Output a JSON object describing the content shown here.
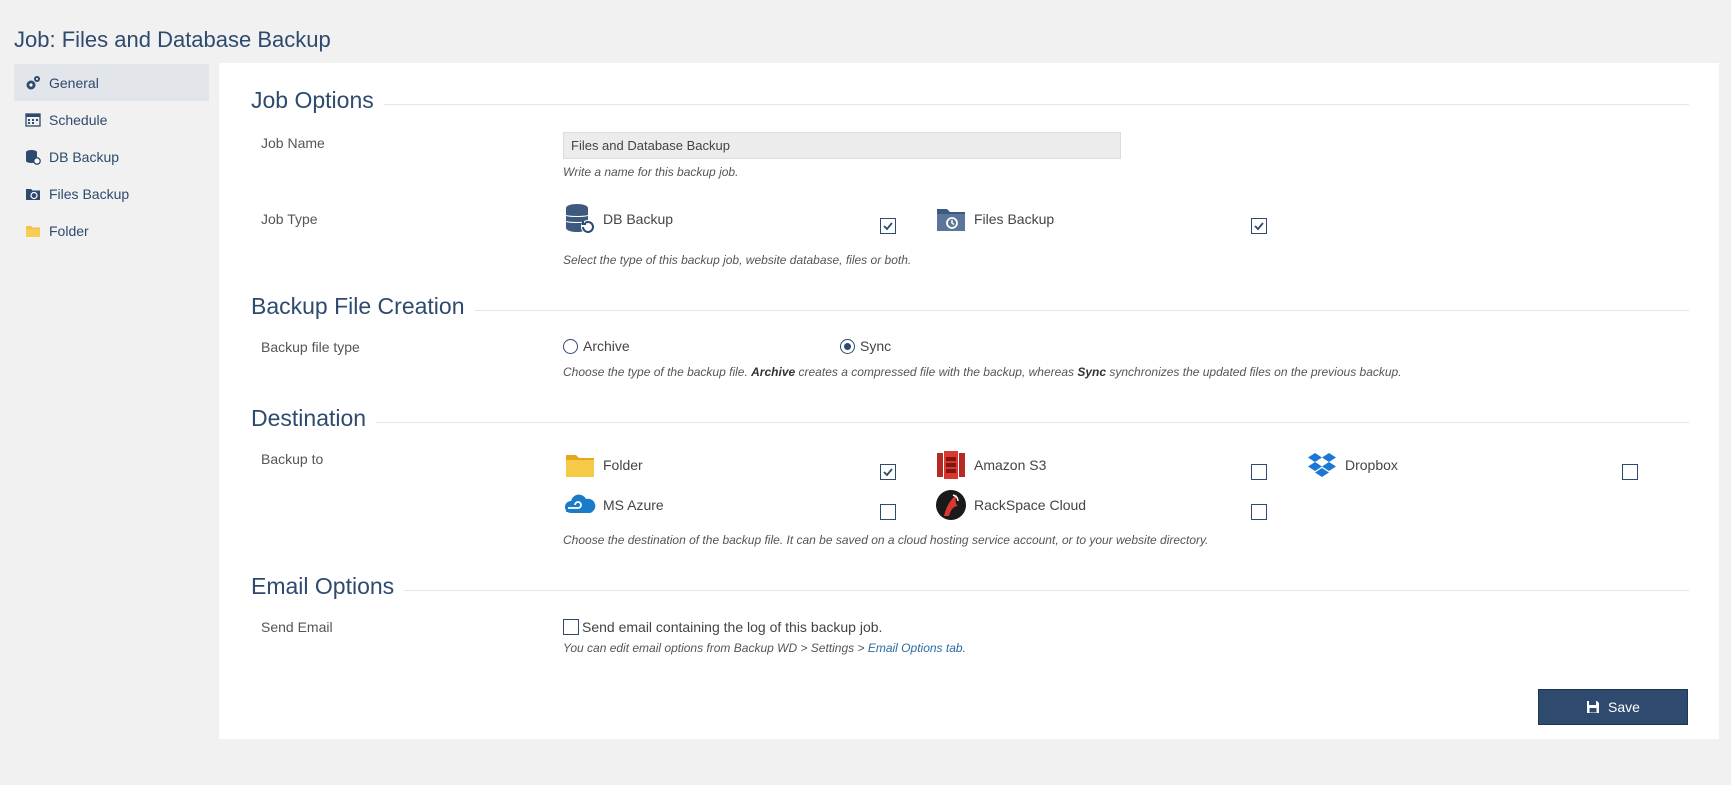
{
  "page_title": "Job: Files and Database Backup",
  "sidebar": {
    "items": [
      {
        "label": "General",
        "icon": "gear-icon",
        "active": true
      },
      {
        "label": "Schedule",
        "icon": "calendar-icon"
      },
      {
        "label": "DB Backup",
        "icon": "database-icon"
      },
      {
        "label": "Files Backup",
        "icon": "files-backup-icon"
      },
      {
        "label": "Folder",
        "icon": "folder-icon"
      }
    ]
  },
  "job_options": {
    "heading": "Job Options",
    "job_name": {
      "label": "Job Name",
      "value": "Files and Database Backup",
      "help": "Write a name for this backup job."
    },
    "job_type": {
      "label": "Job Type",
      "options": [
        {
          "label": "DB Backup",
          "icon": "database-restore-icon",
          "checked": true
        },
        {
          "label": "Files Backup",
          "icon": "folder-history-icon",
          "checked": true
        }
      ],
      "help": "Select the type of this backup job, website database, files or both."
    }
  },
  "backup_file_creation": {
    "heading": "Backup File Creation",
    "file_type": {
      "label": "Backup file type",
      "options": [
        {
          "label": "Archive",
          "selected": false
        },
        {
          "label": "Sync",
          "selected": true
        }
      ],
      "help_pre": "Choose the type of the backup file.",
      "help_archive": "Archive",
      "help_mid": "creates a compressed file with the backup, whereas",
      "help_sync": "Sync",
      "help_post": "synchronizes the updated files on the previous backup."
    }
  },
  "destination": {
    "heading": "Destination",
    "backup_to": {
      "label": "Backup to",
      "options": [
        {
          "label": "Folder",
          "icon": "folder-icon",
          "checked": true
        },
        {
          "label": "Amazon S3",
          "icon": "amazon-s3-icon",
          "checked": false
        },
        {
          "label": "Dropbox",
          "icon": "dropbox-icon",
          "checked": false
        },
        {
          "label": "MS Azure",
          "icon": "azure-cloud-icon",
          "checked": false
        },
        {
          "label": "RackSpace Cloud",
          "icon": "rackspace-icon",
          "checked": false
        }
      ],
      "help": "Choose the destination of the backup file. It can be saved on a cloud hosting service account, or to your website directory."
    }
  },
  "email_options": {
    "heading": "Email Options",
    "send_email": {
      "label": "Send Email",
      "checkbox_label": "Send email containing the log of this backup job.",
      "checked": false,
      "help_pre": "You can edit email options from Backup WD > Settings >",
      "help_link": "Email Options tab",
      "help_post": "."
    }
  },
  "save_label": "Save",
  "colors": {
    "accent": "#2e4a6e",
    "folder_yellow": "#f5c342",
    "amazon_red": "#d9382f",
    "dropbox_blue": "#1b77d6",
    "azure_blue": "#1a7bc8"
  }
}
